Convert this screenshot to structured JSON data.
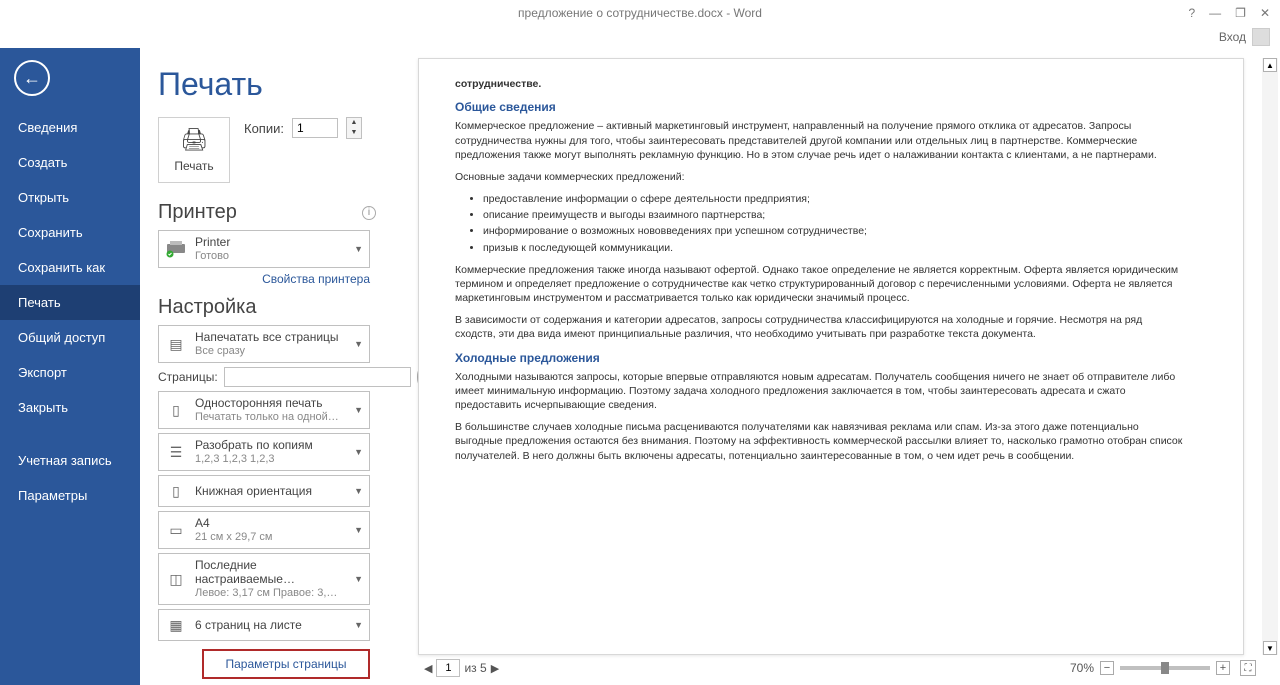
{
  "titlebar": {
    "title": "предложение о сотрудничестве.docx - Word",
    "login": "Вход"
  },
  "sidebar": {
    "items": [
      {
        "label": "Сведения"
      },
      {
        "label": "Создать"
      },
      {
        "label": "Открыть"
      },
      {
        "label": "Сохранить"
      },
      {
        "label": "Сохранить как"
      },
      {
        "label": "Печать"
      },
      {
        "label": "Общий доступ"
      },
      {
        "label": "Экспорт"
      },
      {
        "label": "Закрыть"
      }
    ],
    "bottom": [
      {
        "label": "Учетная запись"
      },
      {
        "label": "Параметры"
      }
    ]
  },
  "print": {
    "heading": "Печать",
    "button_label": "Печать",
    "copies_label": "Копии:",
    "copies_value": "1",
    "printer_heading": "Принтер",
    "printer_name": "Printer",
    "printer_status": "Готово",
    "printer_props": "Свойства принтера",
    "settings_heading": "Настройка",
    "pages_label": "Страницы:",
    "pages_value": "",
    "options": {
      "range": {
        "title": "Напечатать все страницы",
        "sub": "Все сразу"
      },
      "sides": {
        "title": "Односторонняя печать",
        "sub": "Печатать только на одной…"
      },
      "collate": {
        "title": "Разобрать по копиям",
        "sub": "1,2,3   1,2,3   1,2,3"
      },
      "orientation": {
        "title": "Книжная ориентация"
      },
      "paper": {
        "title": "A4",
        "sub": "21 см x 29,7 см"
      },
      "margins": {
        "title": "Последние настраиваемые…",
        "sub": "Левое:  3,17 см   Правое:  3,…"
      },
      "perpage": {
        "title": "6 страниц на листе"
      }
    },
    "page_setup": "Параметры страницы"
  },
  "preview": {
    "top_line": "сотрудничестве.",
    "h1": "Общие сведения",
    "p1": "Коммерческое предложение – активный маркетинговый инструмент, направленный на получение прямого отклика от адресатов. Запросы сотрудничества нужны для того, чтобы заинтересовать представителей другой компании или отдельных лиц в партнерстве. Коммерческие предложения также могут выполнять рекламную функцию. Но в этом случае речь идет о налаживании контакта с клиентами, а не партнерами.",
    "p2": "Основные задачи коммерческих предложений:",
    "bullets": [
      "предоставление информации о сфере деятельности предприятия;",
      "описание преимуществ и выгоды взаимного партнерства;",
      "информирование о возможных нововведениях при успешном сотрудничестве;",
      "призыв к последующей коммуникации."
    ],
    "p3": "Коммерческие предложения также иногда называют офертой. Однако такое определение не является корректным. Оферта является юридическим термином и определяет предложение о сотрудничестве как четко структурированный договор с перечисленными условиями. Оферта не является маркетинговым инструментом и рассматривается только как юридически значимый процесс.",
    "p4": "В зависимости от содержания и категории адресатов, запросы сотрудничества классифицируются на холодные и горячие. Несмотря на ряд сходств, эти два вида имеют принципиальные различия, что необходимо учитывать при разработке текста документа.",
    "h2": "Холодные предложения",
    "p5": "Холодными называются запросы, которые впервые отправляются новым адресатам. Получатель сообщения ничего не знает об отправителе либо имеет минимальную информацию. Поэтому задача холодного предложения заключается в том, чтобы заинтересовать адресата и сжато предоставить исчерпывающие сведения.",
    "p6": "В большинстве случаев холодные письма расцениваются получателями как навязчивая реклама или спам. Из-за этого даже потенциально выгодные предложения остаются без внимания. Поэтому на эффективность коммерческой рассылки влияет то, насколько грамотно отобран список получателей. В него должны быть включены адресаты, потенциально заинтересованные в том, о чем идет речь в сообщении."
  },
  "footer": {
    "page_current": "1",
    "page_of": "из 5",
    "zoom": "70%"
  }
}
